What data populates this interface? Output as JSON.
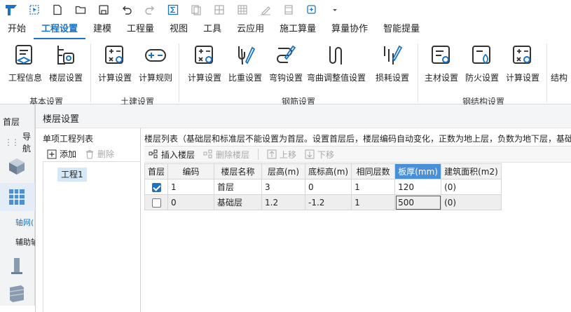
{
  "quick_access": {
    "icons": [
      "logo-icon",
      "select-icon",
      "new-file-icon",
      "open-folder-icon",
      "save-icon",
      "undo-icon",
      "redo-icon",
      "formula-icon",
      "copy-icon",
      "grid-icon",
      "table-icon",
      "draw-icon",
      "film-icon",
      "add-icon",
      "dropdown-icon"
    ]
  },
  "tabs": [
    "开始",
    "工程设置",
    "建模",
    "工程量",
    "视图",
    "工具",
    "云应用",
    "施工算量",
    "算量协作",
    "智能提量"
  ],
  "active_tab": "工程设置",
  "ribbon": {
    "buttons": [
      "工程信息",
      "楼层设置",
      "计算设置",
      "计算规则",
      "计算设置",
      "比重设置",
      "弯钩设置",
      "弯曲调整值设置",
      "损耗设置",
      "主材设置",
      "防火设置",
      "计算设置",
      "结构"
    ],
    "groups": [
      "基本设置",
      "土建设置",
      "钢筋设置",
      "钢结构设置"
    ]
  },
  "left_strip": {
    "floor": "首层",
    "nav_label": "导航",
    "axis_item": "轴网(",
    "aux_item": "辅助轴"
  },
  "dialog": {
    "title": "楼层设置",
    "project_list": {
      "title": "单项工程列表",
      "add": "添加",
      "delete": "删除",
      "items": [
        "工程1"
      ]
    },
    "floor_list": {
      "title": "楼层列表（基础层和标准层不能设置为首层。设置首层后，楼层编码自动变化，正数为地上层，负数为地下层，基础",
      "insert": "插入楼层",
      "delete": "删除楼层",
      "up": "上移",
      "down": "下移",
      "columns": [
        "首层",
        "编码",
        "楼层名称",
        "层高(m)",
        "底标高(m)",
        "相同层数",
        "板厚(mm)",
        "建筑面积(m2)"
      ],
      "rows": [
        {
          "first": true,
          "code": "1",
          "name": "首层",
          "height": "3",
          "bottom": "0",
          "same": "1",
          "thick": "120",
          "area": "(0)"
        },
        {
          "first": false,
          "code": "0",
          "name": "基础层",
          "height": "1.2",
          "bottom": "-1.2",
          "same": "1",
          "thick": "500",
          "area": "(0)"
        }
      ]
    }
  },
  "colors": {
    "accent": "#1a73c7",
    "header_highlight": "#4a90d9"
  }
}
